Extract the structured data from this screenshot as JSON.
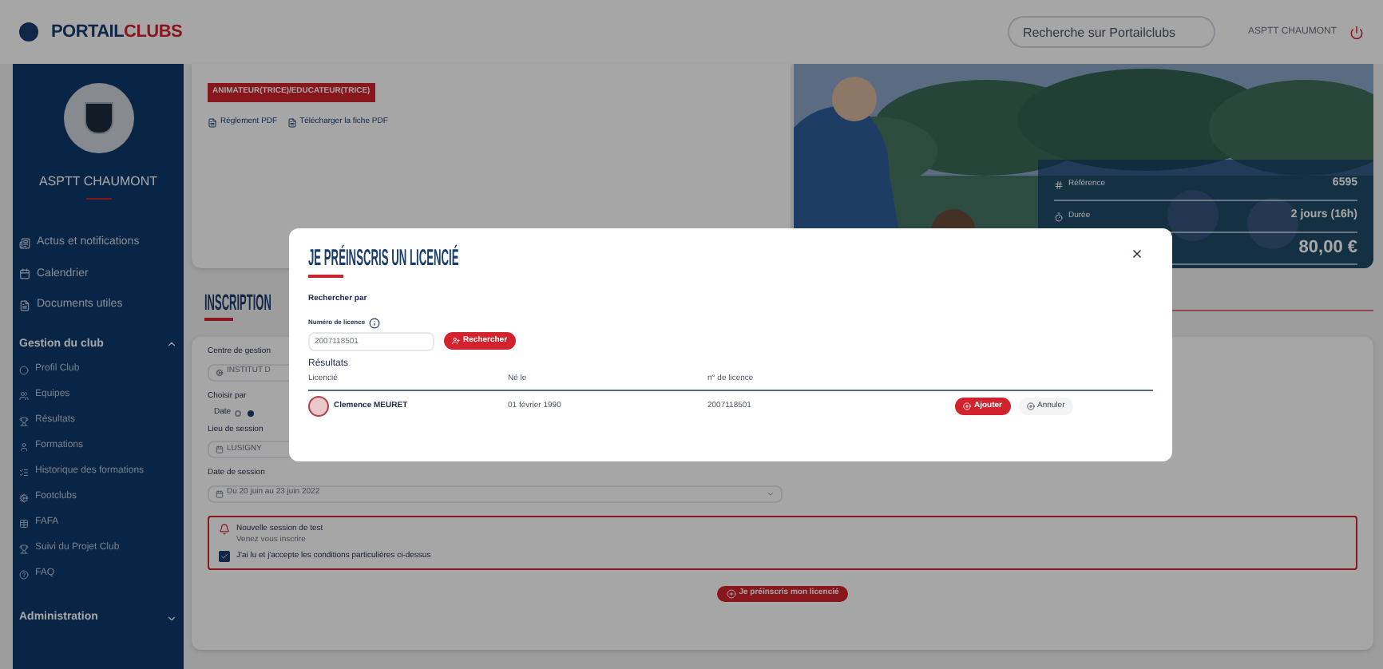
{
  "header": {
    "logo_prefix": "PORTAIL",
    "logo_suffix": "CLUBS",
    "search": {
      "placeholder": "Recherche sur Portailclubs"
    },
    "user": "ASPTT CHAUMONT"
  },
  "sidebar": {
    "club_name": "ASPTT CHAUMONT",
    "top_items": [
      {
        "label": "Actus et notifications"
      },
      {
        "label": "Calendrier"
      },
      {
        "label": "Documents utiles"
      }
    ],
    "groups": [
      {
        "label": "Gestion du club",
        "expanded": true,
        "items": [
          {
            "label": "Profil Club"
          },
          {
            "label": "Equipes"
          },
          {
            "label": "Résultats"
          },
          {
            "label": "Formations"
          },
          {
            "label": "Historique des formations"
          },
          {
            "label": "Footclubs"
          },
          {
            "label": "FAFA"
          },
          {
            "label": "Suivi du Projet Club"
          },
          {
            "label": "FAQ"
          }
        ]
      },
      {
        "label": "Administration",
        "expanded": false
      }
    ]
  },
  "course": {
    "badge": "ANIMATEUR(TRICE)/EDUCATEUR(TRICE)",
    "links": [
      "Règlement PDF",
      "Télécharger la fiche PDF"
    ],
    "info": [
      {
        "label": "Référence",
        "value": "6595"
      },
      {
        "label": "Durée",
        "value": "2 jours (16h)"
      },
      {
        "value": "80,00 €"
      }
    ]
  },
  "inscription": {
    "title": "INSCRIPTION",
    "centre_label": "Centre de gestion",
    "centre_value": "INSTITUT D",
    "choose_label": "Choisir par",
    "radios": [
      {
        "label": "Date",
        "selected": false
      },
      {
        "selected": true
      }
    ],
    "lieu_label": "Lieu de session",
    "lieu_value": "LUSIGNY",
    "date_label": "Date de session",
    "date_value": "Du 20 juin au 23 juin 2022",
    "alert_title": "Nouvelle session de test",
    "alert_text": "Venez vous inscrire",
    "terms": {
      "label": "J'ai lu et j'accepte les conditions particulières ci-dessus",
      "checked": true
    },
    "submit": "Je préinscris mon licencié"
  },
  "modal": {
    "title": "JE PRÉINSCRIS UN LICENCIÉ",
    "search_by": "Rechercher par",
    "field_label": "Numéro de licence",
    "field_value": "2007118501",
    "search_button": "Rechercher",
    "results_title": "Résultats",
    "columns": [
      "Licencié",
      "Né le",
      "n° de licence"
    ],
    "rows": [
      {
        "name": "Clemence MEURET",
        "born": "01 février 1990",
        "licence": "2007118501",
        "add": "Ajouter",
        "cancel": "Annuler"
      }
    ]
  }
}
